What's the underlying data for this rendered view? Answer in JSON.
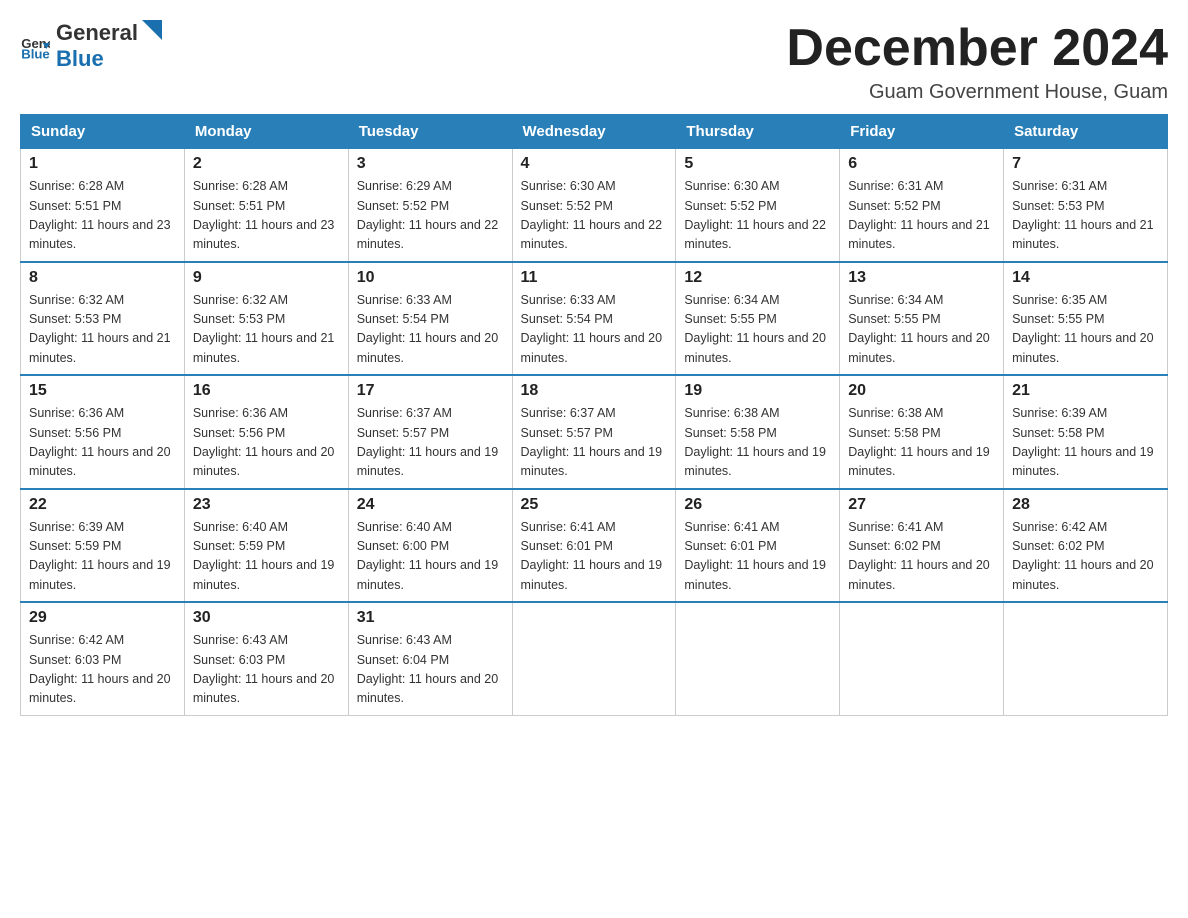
{
  "header": {
    "logo_general": "General",
    "logo_blue": "Blue",
    "title": "December 2024",
    "subtitle": "Guam Government House, Guam"
  },
  "weekdays": [
    "Sunday",
    "Monday",
    "Tuesday",
    "Wednesday",
    "Thursday",
    "Friday",
    "Saturday"
  ],
  "weeks": [
    [
      {
        "day": "1",
        "sunrise": "6:28 AM",
        "sunset": "5:51 PM",
        "daylight": "11 hours and 23 minutes."
      },
      {
        "day": "2",
        "sunrise": "6:28 AM",
        "sunset": "5:51 PM",
        "daylight": "11 hours and 23 minutes."
      },
      {
        "day": "3",
        "sunrise": "6:29 AM",
        "sunset": "5:52 PM",
        "daylight": "11 hours and 22 minutes."
      },
      {
        "day": "4",
        "sunrise": "6:30 AM",
        "sunset": "5:52 PM",
        "daylight": "11 hours and 22 minutes."
      },
      {
        "day": "5",
        "sunrise": "6:30 AM",
        "sunset": "5:52 PM",
        "daylight": "11 hours and 22 minutes."
      },
      {
        "day": "6",
        "sunrise": "6:31 AM",
        "sunset": "5:52 PM",
        "daylight": "11 hours and 21 minutes."
      },
      {
        "day": "7",
        "sunrise": "6:31 AM",
        "sunset": "5:53 PM",
        "daylight": "11 hours and 21 minutes."
      }
    ],
    [
      {
        "day": "8",
        "sunrise": "6:32 AM",
        "sunset": "5:53 PM",
        "daylight": "11 hours and 21 minutes."
      },
      {
        "day": "9",
        "sunrise": "6:32 AM",
        "sunset": "5:53 PM",
        "daylight": "11 hours and 21 minutes."
      },
      {
        "day": "10",
        "sunrise": "6:33 AM",
        "sunset": "5:54 PM",
        "daylight": "11 hours and 20 minutes."
      },
      {
        "day": "11",
        "sunrise": "6:33 AM",
        "sunset": "5:54 PM",
        "daylight": "11 hours and 20 minutes."
      },
      {
        "day": "12",
        "sunrise": "6:34 AM",
        "sunset": "5:55 PM",
        "daylight": "11 hours and 20 minutes."
      },
      {
        "day": "13",
        "sunrise": "6:34 AM",
        "sunset": "5:55 PM",
        "daylight": "11 hours and 20 minutes."
      },
      {
        "day": "14",
        "sunrise": "6:35 AM",
        "sunset": "5:55 PM",
        "daylight": "11 hours and 20 minutes."
      }
    ],
    [
      {
        "day": "15",
        "sunrise": "6:36 AM",
        "sunset": "5:56 PM",
        "daylight": "11 hours and 20 minutes."
      },
      {
        "day": "16",
        "sunrise": "6:36 AM",
        "sunset": "5:56 PM",
        "daylight": "11 hours and 20 minutes."
      },
      {
        "day": "17",
        "sunrise": "6:37 AM",
        "sunset": "5:57 PM",
        "daylight": "11 hours and 19 minutes."
      },
      {
        "day": "18",
        "sunrise": "6:37 AM",
        "sunset": "5:57 PM",
        "daylight": "11 hours and 19 minutes."
      },
      {
        "day": "19",
        "sunrise": "6:38 AM",
        "sunset": "5:58 PM",
        "daylight": "11 hours and 19 minutes."
      },
      {
        "day": "20",
        "sunrise": "6:38 AM",
        "sunset": "5:58 PM",
        "daylight": "11 hours and 19 minutes."
      },
      {
        "day": "21",
        "sunrise": "6:39 AM",
        "sunset": "5:58 PM",
        "daylight": "11 hours and 19 minutes."
      }
    ],
    [
      {
        "day": "22",
        "sunrise": "6:39 AM",
        "sunset": "5:59 PM",
        "daylight": "11 hours and 19 minutes."
      },
      {
        "day": "23",
        "sunrise": "6:40 AM",
        "sunset": "5:59 PM",
        "daylight": "11 hours and 19 minutes."
      },
      {
        "day": "24",
        "sunrise": "6:40 AM",
        "sunset": "6:00 PM",
        "daylight": "11 hours and 19 minutes."
      },
      {
        "day": "25",
        "sunrise": "6:41 AM",
        "sunset": "6:01 PM",
        "daylight": "11 hours and 19 minutes."
      },
      {
        "day": "26",
        "sunrise": "6:41 AM",
        "sunset": "6:01 PM",
        "daylight": "11 hours and 19 minutes."
      },
      {
        "day": "27",
        "sunrise": "6:41 AM",
        "sunset": "6:02 PM",
        "daylight": "11 hours and 20 minutes."
      },
      {
        "day": "28",
        "sunrise": "6:42 AM",
        "sunset": "6:02 PM",
        "daylight": "11 hours and 20 minutes."
      }
    ],
    [
      {
        "day": "29",
        "sunrise": "6:42 AM",
        "sunset": "6:03 PM",
        "daylight": "11 hours and 20 minutes."
      },
      {
        "day": "30",
        "sunrise": "6:43 AM",
        "sunset": "6:03 PM",
        "daylight": "11 hours and 20 minutes."
      },
      {
        "day": "31",
        "sunrise": "6:43 AM",
        "sunset": "6:04 PM",
        "daylight": "11 hours and 20 minutes."
      },
      null,
      null,
      null,
      null
    ]
  ]
}
